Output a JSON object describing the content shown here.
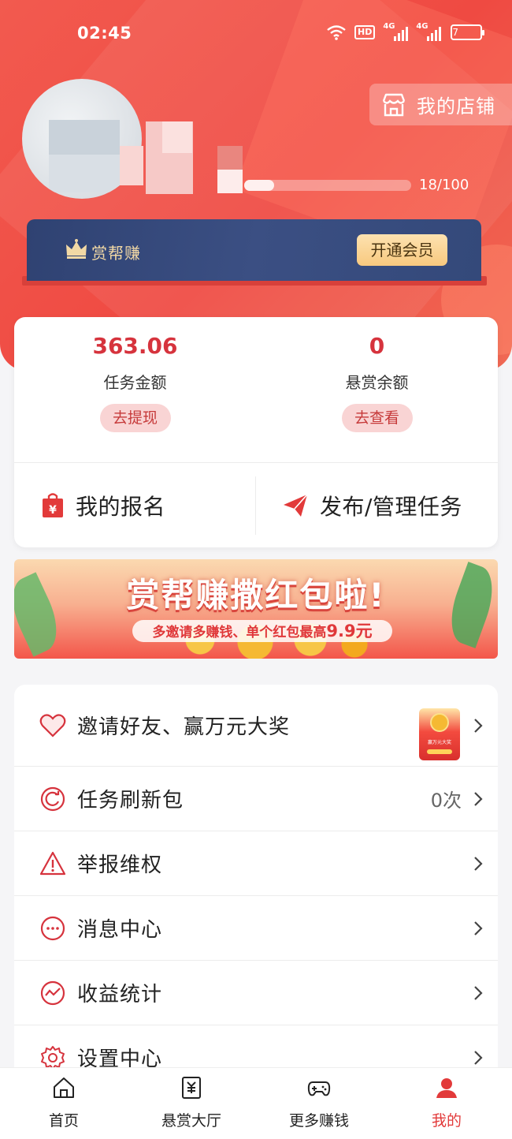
{
  "status_bar": {
    "time": "02:45",
    "hd_label": "HD",
    "sim1_label": "4G",
    "sim2_label": "4G",
    "battery": "7"
  },
  "profile": {
    "shop_button_label": "我的店铺",
    "progress_text": "18/100",
    "progress_value": 0.18
  },
  "vip": {
    "label": "赏帮赚",
    "open_button": "开通会员"
  },
  "balances": [
    {
      "amount": "363.06",
      "label": "任务金额",
      "button": "去提现"
    },
    {
      "amount": "0",
      "label": "悬赏余额",
      "button": "去查看"
    }
  ],
  "actions": {
    "signup": "我的报名",
    "publish": "发布/管理任务"
  },
  "banner": {
    "title": "赏帮赚撒红包啦!",
    "subtitle_prefix": "多邀请多赚钱、单个红包最高",
    "subtitle_highlight": "9.9元"
  },
  "menu": [
    {
      "label": "邀请好友、赢万元大奖",
      "value": "",
      "icon": "heart-icon"
    },
    {
      "label": "任务刷新包",
      "value": "0次",
      "icon": "refresh-icon"
    },
    {
      "label": "举报维权",
      "value": "",
      "icon": "warning-icon"
    },
    {
      "label": "消息中心",
      "value": "",
      "icon": "message-icon"
    },
    {
      "label": "收益统计",
      "value": "",
      "icon": "chart-icon"
    },
    {
      "label": "设置中心",
      "value": "",
      "icon": "gear-icon"
    }
  ],
  "promo_card": {
    "text": "赢万元大奖"
  },
  "nav": [
    {
      "label": "首页",
      "icon": "home-icon",
      "active": false
    },
    {
      "label": "悬赏大厅",
      "icon": "bounty-icon",
      "active": false
    },
    {
      "label": "更多赚钱",
      "icon": "gamepad-icon",
      "active": false
    },
    {
      "label": "我的",
      "icon": "user-icon",
      "active": true
    }
  ],
  "colors": {
    "accent": "#ef4a42",
    "amount_red": "#d6333d",
    "vip_navy": "#34497a",
    "vip_gold": "#f8c97f"
  }
}
